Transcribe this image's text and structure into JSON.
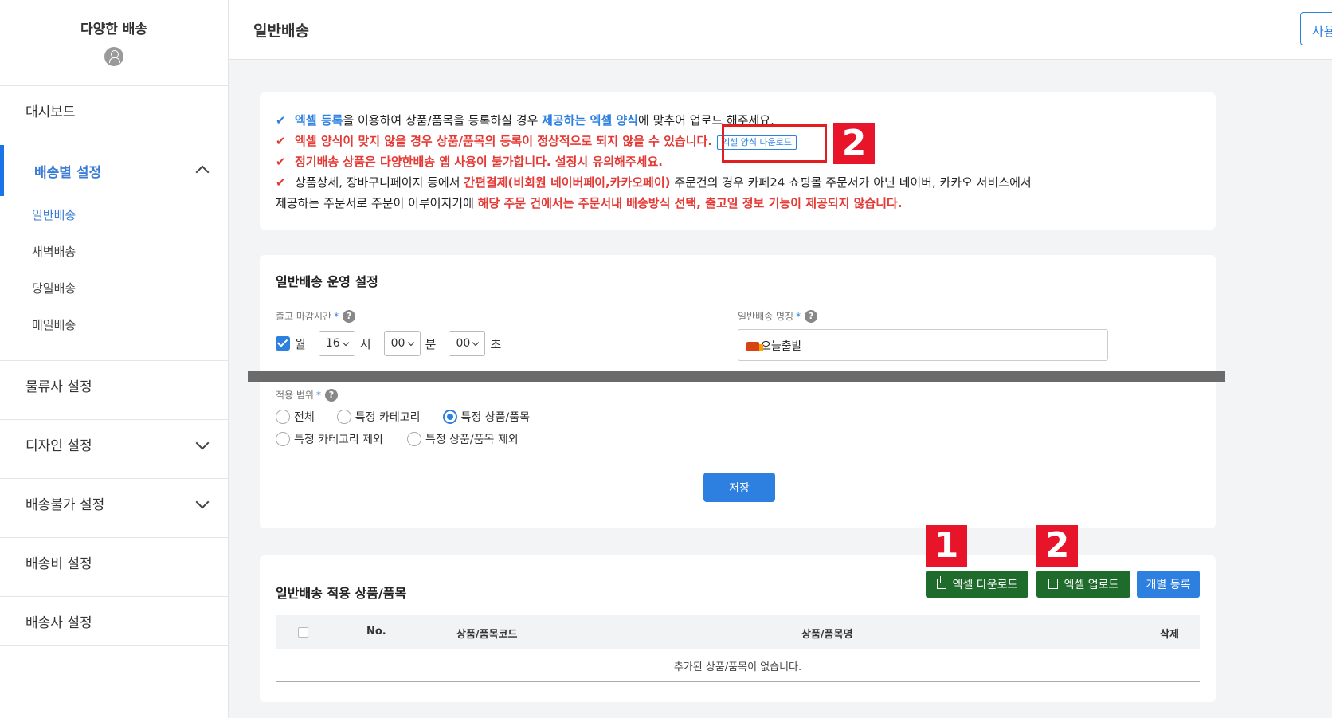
{
  "sidebar": {
    "brand": "다양한 배송",
    "items": {
      "dashboard": "대시보드",
      "shipping_settings": "배송별 설정",
      "sub_general": "일반배송",
      "sub_dawn": "새벽배송",
      "sub_sameday": "당일배송",
      "sub_daily": "매일배송",
      "logistics": "물류사 설정",
      "design": "디자인 설정",
      "unavailable": "배송불가 설정",
      "fee": "배송비 설정",
      "carrier": "배송사 설정"
    }
  },
  "header": {
    "title": "일반배송",
    "right_button": "사용"
  },
  "notice": {
    "line1_a": "엑셀 등록",
    "line1_b": "을 이용하여 상품/품목을 등록하실 경우 ",
    "line1_c": "제공하는 엑셀 양식",
    "line1_d": "에 맞추어 업로드 해주세요.",
    "line2": "엑셀 양식이 맞지 않을 경우 상품/품목의 등록이 정상적으로 되지 않을 수 있습니다.",
    "line2_btn": "엑셀 양식 다운로드",
    "line3": "정기배송 상품은 다양한배송 앱 사용이 불가합니다. 설정시 유의해주세요.",
    "line4_a": "상품상세, 장바구니페이지 등에서 ",
    "line4_b": "간편결제(비회원 네이버페이,카카오페이)",
    "line4_c": " 주문건의 경우 카페24 쇼핑몰 주문서가 아닌 네이버, 카카오 서비스에서",
    "line5_a": "제공하는 주문서로 주문이 이루어지기에 ",
    "line5_b": "해당 주문 건에서는 주문서내 배송방식 선택, 출고일 정보 기능이 제공되지 않습니다.",
    "check": "✔"
  },
  "markers": {
    "one": "1",
    "two": "2"
  },
  "settings": {
    "title": "일반배송 운영 설정",
    "cutoff_label": "출고 마감시간",
    "required": "*",
    "help": "?",
    "day": "월",
    "hour": "16",
    "hour_unit": "시",
    "minute": "00",
    "minute_unit": "분",
    "second": "00",
    "second_unit": "초",
    "name_label": "일반배송 명칭",
    "name_value": "오늘출발",
    "scope_label": "적용 범위",
    "scope_all": "전체",
    "scope_category": "특정 카테고리",
    "scope_product": "특정 상품/품목",
    "scope_exclude_category": "특정 카테고리 제외",
    "scope_exclude_product": "특정 상품/품목 제외",
    "save": "저장"
  },
  "products": {
    "title": "일반배송 적용 상품/품목",
    "excel_download": "엑셀 다운로드",
    "excel_upload": "엑셀 업로드",
    "individual": "개별 등록",
    "col_no": "No.",
    "col_code": "상품/품목코드",
    "col_name": "상품/품목명",
    "col_delete": "삭제",
    "empty": "추가된 상품/품목이 없습니다."
  },
  "colors": {
    "accent": "#2d7fe0",
    "warning": "#e53935",
    "green": "#1e6b2b",
    "marker": "#e8142a"
  }
}
